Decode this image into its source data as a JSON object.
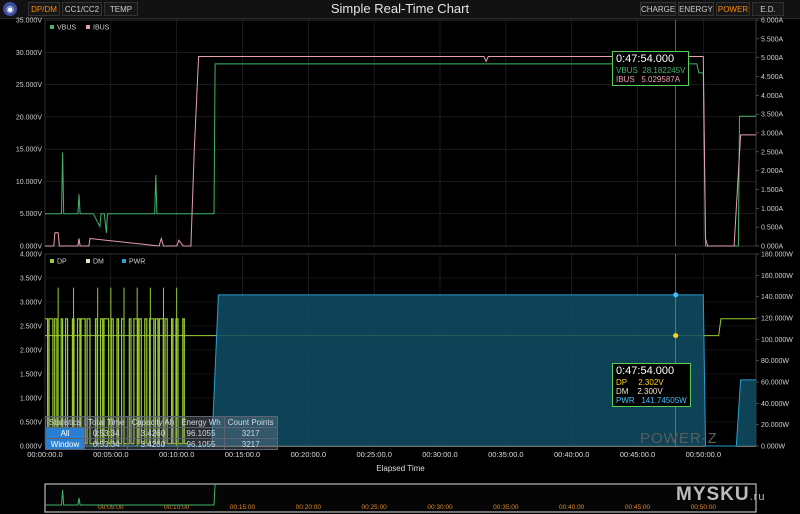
{
  "app": {
    "title": "Simple Real-Time Chart",
    "left_tabs": [
      "DP/DM",
      "CC1/CC2",
      "TEMP"
    ],
    "right_tabs": [
      "CHARGE",
      "ENERGY",
      "POWER",
      "E.D."
    ],
    "active_left": 0,
    "active_right": 2
  },
  "chart_data": [
    {
      "type": "line",
      "title": "Simple Real-Time Chart",
      "xlabel": "",
      "legend": [
        "VBUS",
        "IBUS"
      ],
      "legend_placement": "top-left",
      "xlim": [
        0,
        3240
      ],
      "ylim_left": [
        0,
        35
      ],
      "ylim_right": [
        0,
        6
      ],
      "y_ticks_left": [
        "0.000V",
        "5.000V",
        "10.000V",
        "15.000V",
        "20.000V",
        "25.000V",
        "30.000V",
        "35.000V"
      ],
      "y_ticks_right": [
        "0.000A",
        "0.500A",
        "1.000A",
        "1.500A",
        "2.000A",
        "2.500A",
        "3.000A",
        "3.500A",
        "4.000A",
        "4.500A",
        "5.000A",
        "5.500A",
        "6.000A"
      ],
      "series": [
        {
          "name": "VBUS",
          "axis": "left",
          "color": "#3fb56a",
          "x": [
            0,
            75,
            80,
            85,
            150,
            155,
            160,
            220,
            250,
            255,
            270,
            280,
            285,
            290,
            500,
            505,
            510,
            520,
            530,
            770,
            775,
            2970,
            2980,
            3000,
            3010,
            3020,
            3030,
            3040,
            3050,
            3055,
            3060,
            3140,
            3160,
            3165,
            3200,
            3240
          ],
          "y": [
            5,
            5,
            14.5,
            5,
            5,
            8,
            5,
            5,
            3,
            5,
            5,
            2,
            5,
            5,
            5,
            11,
            5,
            5,
            5,
            5,
            28.2,
            28.2,
            26.8,
            26.8,
            0,
            0,
            0,
            0,
            0,
            0,
            0,
            0,
            0,
            20.1,
            20.1,
            20.1
          ]
        },
        {
          "name": "IBUS",
          "axis": "right",
          "color": "#e8a0b0",
          "x": [
            0,
            40,
            45,
            60,
            65,
            150,
            155,
            160,
            200,
            205,
            520,
            530,
            540,
            600,
            610,
            630,
            665,
            680,
            700,
            710,
            2000,
            2010,
            2020,
            3000,
            3010,
            3020,
            3030,
            3035,
            3050,
            3120,
            3130,
            3140,
            3170,
            3200,
            3240
          ],
          "y": [
            0,
            0,
            0.35,
            0.35,
            0,
            0,
            0.2,
            0,
            0,
            0.2,
            0,
            0.2,
            0,
            0,
            0.15,
            0,
            0,
            2.5,
            5.03,
            5.03,
            5.03,
            4.9,
            5.03,
            5.03,
            0.2,
            0,
            0,
            0,
            0,
            0,
            0,
            0,
            2.95,
            2.95,
            2.95
          ]
        }
      ],
      "cursor": {
        "x_label": "0:47:54.000",
        "VBUS": "28.182245V",
        "IBUS": "5.029587A"
      }
    },
    {
      "type": "line",
      "title": "",
      "xlabel": "Elapsed Time",
      "legend": [
        "DP",
        "DM",
        "PWR"
      ],
      "legend_placement": "top-left",
      "xlim": [
        0,
        3240
      ],
      "ylim_left": [
        0,
        4
      ],
      "ylim_right": [
        0,
        180
      ],
      "y_ticks_left": [
        "0.000V",
        "0.500V",
        "1.000V",
        "1.500V",
        "2.000V",
        "2.500V",
        "3.000V",
        "3.500V",
        "4.000V"
      ],
      "y_ticks_right": [
        "0.000W",
        "20.000W",
        "40.000W",
        "60.000W",
        "80.000W",
        "100.000W",
        "120.000W",
        "140.000W",
        "160.000W",
        "180.000W"
      ],
      "x_ticks": [
        "00:00:00.0",
        "00:05:00.0",
        "00:10:00.0",
        "00:15:00.0",
        "00:20:00.0",
        "00:25:00.0",
        "00:30:00.0",
        "00:35:00.0",
        "00:40:00.0",
        "00:45:00.0",
        "00:50:00.0"
      ],
      "series": [
        {
          "name": "DP",
          "axis": "left",
          "color": "#9acd32",
          "x": [
            0,
            3050,
            3060,
            3070,
            3080,
            3240
          ],
          "y": [
            2.3,
            2.3,
            2.3,
            2.3,
            2.65,
            2.65
          ]
        },
        {
          "name": "DM",
          "axis": "left",
          "color": "#e8e0c8",
          "x": [
            0,
            3240
          ],
          "y": [
            0,
            0
          ]
        },
        {
          "name": "PWR",
          "axis": "right",
          "color": "#2a9fcf",
          "x": [
            0,
            760,
            790,
            830,
            3000,
            3010,
            3030,
            3150,
            3170,
            3240
          ],
          "y": [
            0,
            0,
            141.7,
            141.7,
            141.7,
            0,
            0,
            0,
            62,
            62
          ]
        }
      ],
      "cursor": {
        "x_label": "0:47:54.000",
        "DP": "2.302V",
        "DM": "2.300V",
        "PWR": "141.74505W"
      }
    }
  ],
  "statistics": {
    "headers": [
      "Statistics",
      "Total Time",
      "Capacity Ah",
      "Energy Wh",
      "Count Points"
    ],
    "rows": [
      [
        "All",
        "0:53:34",
        "3.4260",
        "96.1055",
        "3217"
      ],
      [
        "Window",
        "0:53:34",
        "3.4260",
        "96.1055",
        "3217"
      ]
    ]
  },
  "overview_ticks": [
    "00:05:00",
    "00:10:00",
    "00:15:00",
    "00:20:00",
    "00:25:00",
    "00:30:00",
    "00:35:00",
    "00:40:00",
    "00:45:00",
    "00:50:00"
  ],
  "watermark": "POWER-Z",
  "site_mark": {
    "name": "MYSKU",
    "suffix": ".ru"
  }
}
